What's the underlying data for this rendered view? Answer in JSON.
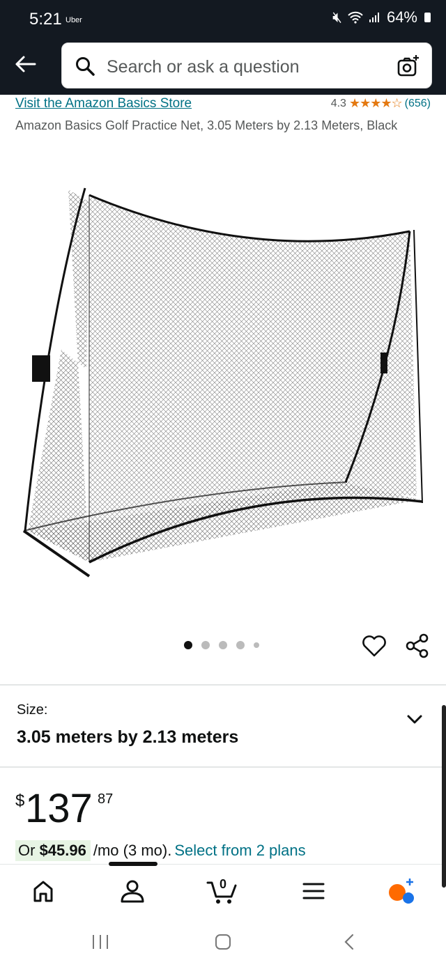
{
  "status": {
    "time": "5:21",
    "carrier": "Uber",
    "battery": "64%"
  },
  "search": {
    "placeholder": "Search or ask a question"
  },
  "product": {
    "store_link": "Visit the Amazon Basics Store",
    "rating": "4.3",
    "stars": "★★★★☆",
    "review_count": "(656)",
    "title": "Amazon Basics Golf Practice Net, 3.05 Meters by 2.13 Meters, Black",
    "image_count": 5,
    "active_image": 1
  },
  "size": {
    "label": "Size:",
    "value": "3.05 meters by 2.13 meters"
  },
  "price": {
    "currency": "$",
    "whole": "137",
    "fraction": "87"
  },
  "installment": {
    "prefix": "Or ",
    "amount": "$45.96",
    "suffix": "/mo (3 mo).",
    "link": "Select from 2 plans"
  },
  "bottom_nav": {
    "cart_count": "0"
  },
  "colors": {
    "header": "#131921",
    "link": "#007185",
    "star": "#e47911",
    "installment_bg": "#e7f4e4"
  },
  "icons": [
    "back-arrow-icon",
    "search-icon",
    "camera-icon",
    "heart-icon",
    "share-icon",
    "chevron-down-icon",
    "home-icon",
    "account-icon",
    "cart-icon",
    "menu-icon",
    "rufus-icon"
  ]
}
